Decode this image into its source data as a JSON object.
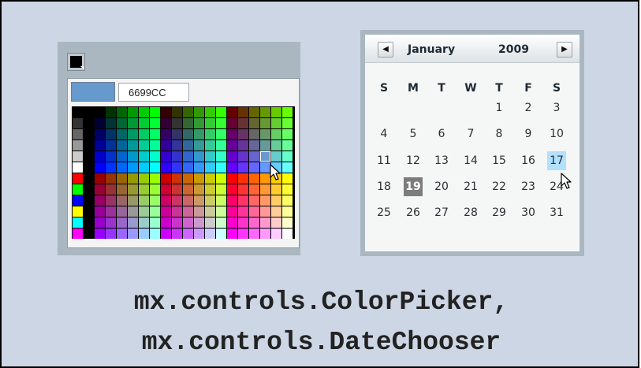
{
  "color_picker": {
    "selected_swatch_color": "#000000",
    "preview_color": "#6699CC",
    "hex_value": "6699CC",
    "highlighted_color": "#6699CC"
  },
  "date_chooser": {
    "prev_icon": "left-arrow-icon",
    "next_icon": "right-arrow-icon",
    "month": "January",
    "year": "2009",
    "day_names": [
      "S",
      "M",
      "T",
      "W",
      "T",
      "F",
      "S"
    ],
    "weeks": [
      [
        "",
        "",
        "",
        "",
        "1",
        "2",
        "3"
      ],
      [
        "4",
        "5",
        "6",
        "7",
        "8",
        "9",
        "10"
      ],
      [
        "11",
        "12",
        "13",
        "14",
        "15",
        "16",
        "17"
      ],
      [
        "18",
        "19",
        "20",
        "21",
        "22",
        "23",
        "24"
      ],
      [
        "25",
        "26",
        "27",
        "28",
        "29",
        "30",
        "31"
      ]
    ],
    "today": "19",
    "hovered": "17",
    "today_color": "#7c7c7c",
    "hover_color": "#b2e1ff"
  },
  "caption": {
    "line1": "mx.controls.ColorPicker,",
    "line2": "mx.controls.DateChooser"
  }
}
